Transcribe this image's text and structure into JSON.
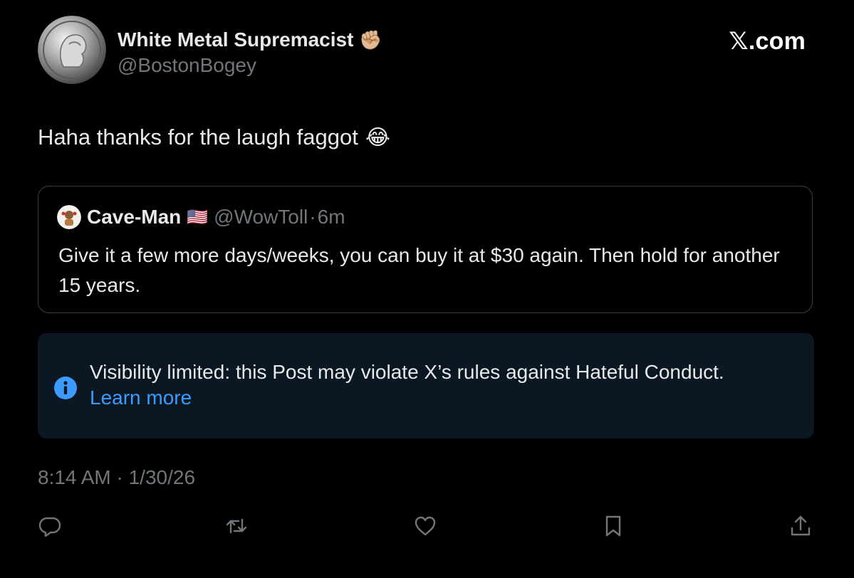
{
  "author": {
    "display_name": "White Metal Supremacist",
    "name_emoji": "✊🏼",
    "handle": "@BostonBogey",
    "avatar_icon": "coin-avatar-icon"
  },
  "brand": "𝕏.com",
  "post": {
    "text": "Haha thanks for the laugh faggot",
    "emoji": "😂"
  },
  "quote": {
    "name": "Cave-Man",
    "flag": "🇺🇸",
    "handle": "@WowToll",
    "separator": "·",
    "time": "6m",
    "text": "Give it a few more days/weeks, you can buy it at $30 again.  Then hold for another 15 years."
  },
  "notice": {
    "text": "Visibility limited: this Post may violate X’s rules against Hateful Conduct.",
    "link": "Learn more",
    "icon": "info-icon",
    "accent": "#3d9bff",
    "background": "#0b1722"
  },
  "timestamp": "8:14 AM · 1/30/26",
  "actions": {
    "icons": [
      "reply-icon",
      "repost-icon",
      "like-icon",
      "bookmark-icon",
      "share-icon"
    ]
  },
  "colors": {
    "background": "#000000",
    "text": "#e7e9ea",
    "muted": "#71767b",
    "link": "#3d9bff",
    "border": "#3a3f44"
  }
}
